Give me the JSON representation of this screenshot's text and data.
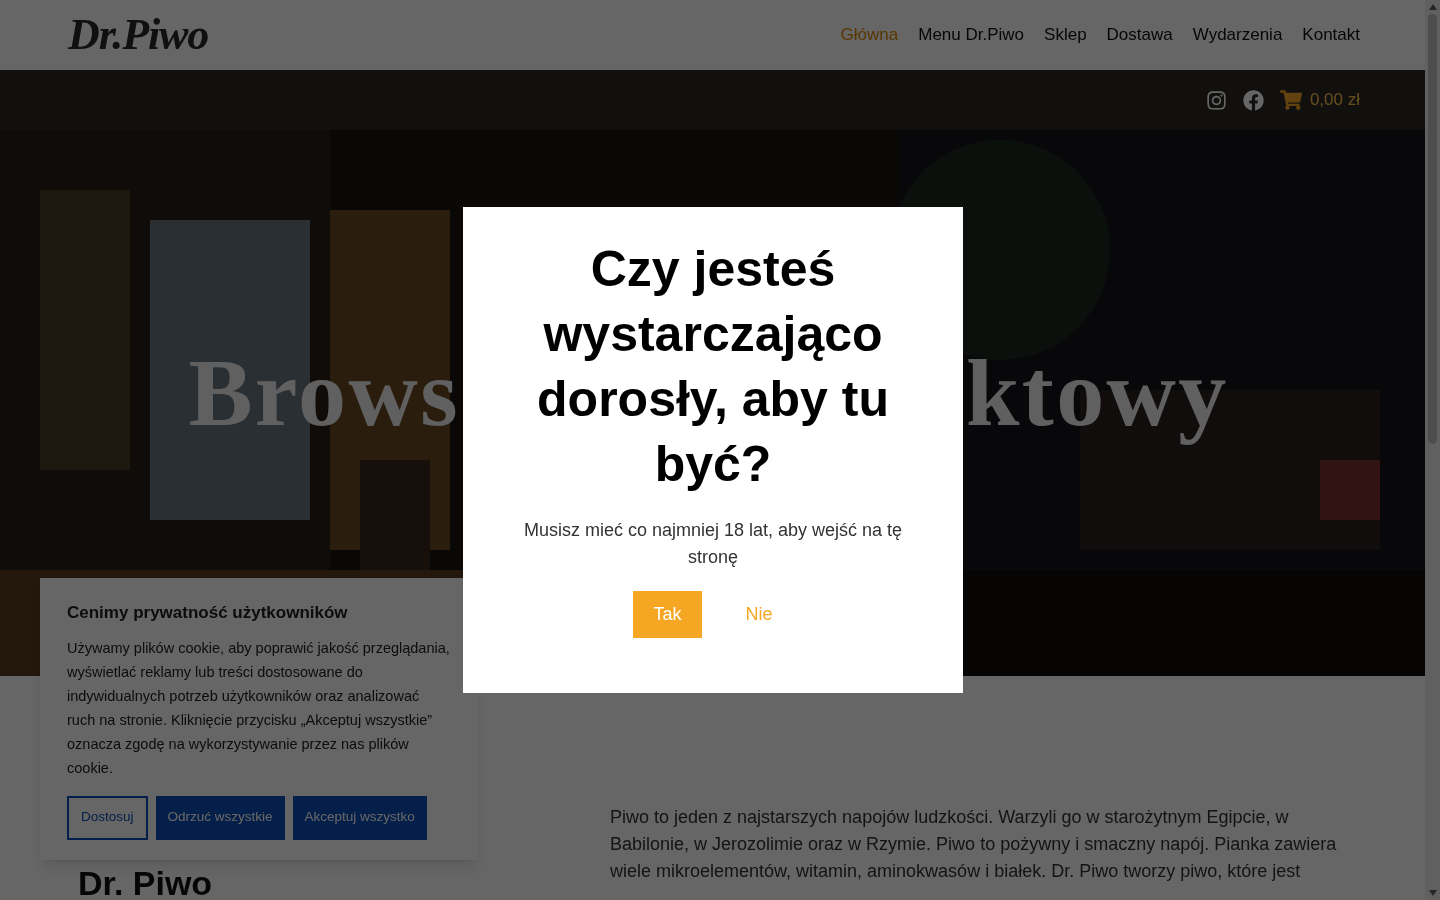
{
  "header": {
    "logo": "Dr.Piwo",
    "nav": [
      {
        "label": "Główna",
        "selected": true
      },
      {
        "label": "Menu Dr.Piwo",
        "selected": false
      },
      {
        "label": "Sklep",
        "selected": false
      },
      {
        "label": "Dostawa",
        "selected": false
      },
      {
        "label": "Wydarzenia",
        "selected": false
      },
      {
        "label": "Kontakt",
        "selected": false
      }
    ],
    "cart_total": "0,00 zł"
  },
  "hero": {
    "title_left": "Brows",
    "title_right": "ktowy"
  },
  "content": {
    "heading": "Dr. Piwo",
    "paragraph": "Piwo to jeden z najstarszych napojów ludzkości. Warzyli go w starożytnym Egipcie, w Babilonie, w Jerozolimie oraz w Rzymie. Piwo to pożywny i smaczny napój. Pianka zawiera wiele mikroelementów, witamin, aminokwasów i białek. Dr. Piwo tworzy piwo, które jest"
  },
  "cookie_banner": {
    "title": "Cenimy prywatność użytkowników",
    "text": "Używamy plików cookie, aby poprawić jakość przeglądania, wyświetlać reklamy lub treści dostosowane do indywidualnych potrzeb użytkowników oraz analizować ruch na stronie. Kliknięcie przycisku „Akceptuj wszystkie” oznacza zgodę na wykorzystywanie przez nas plików cookie.",
    "buttons": [
      {
        "label": "Dostosuj",
        "kind": "outline"
      },
      {
        "label": "Odrzuć wszystkie",
        "kind": "solid"
      },
      {
        "label": "Akceptuj wszystko",
        "kind": "solid"
      }
    ]
  },
  "age_modal": {
    "title": "Czy jesteś wystarczająco dorosły, aby tu być?",
    "text": "Musisz mieć co najmniej 18 lat, aby wejść na tę stronę",
    "buttons": [
      {
        "label": "Tak",
        "kind": "primary"
      },
      {
        "label": "Nie",
        "kind": "link"
      }
    ]
  }
}
